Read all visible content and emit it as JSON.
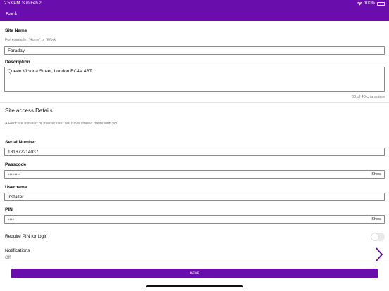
{
  "status_bar": {
    "time": "2:53 PM",
    "date": "Sun Feb 2",
    "battery": "100%"
  },
  "nav": {
    "back_label": "Back"
  },
  "form": {
    "site_name_label": "Site Name",
    "site_name_hint": "For example, 'Home' or 'Work'",
    "site_name_value": "Faraday",
    "description_label": "Description",
    "description_value": "Queen Victoria Street, London EC4V 4BT",
    "description_counter": "38 of 40 characters",
    "section_title": "Site access Details",
    "section_hint": "A Redcare Installer or master user will have shared these with you",
    "serial_label": "Serial Number",
    "serial_value": "181672214037",
    "passcode_label": "Passcode",
    "passcode_value": "••••••••",
    "passcode_show": "Show",
    "username_label": "Username",
    "username_value": "installer",
    "pin_label": "PIN",
    "pin_value": "••••",
    "pin_show": "Show",
    "require_pin_label": "Require PIN for login",
    "require_pin_on": false,
    "notifications_label": "Notifications",
    "notifications_value": "Off"
  },
  "footer": {
    "save_label": "Save"
  },
  "colors": {
    "brand": "#6a0dad"
  }
}
